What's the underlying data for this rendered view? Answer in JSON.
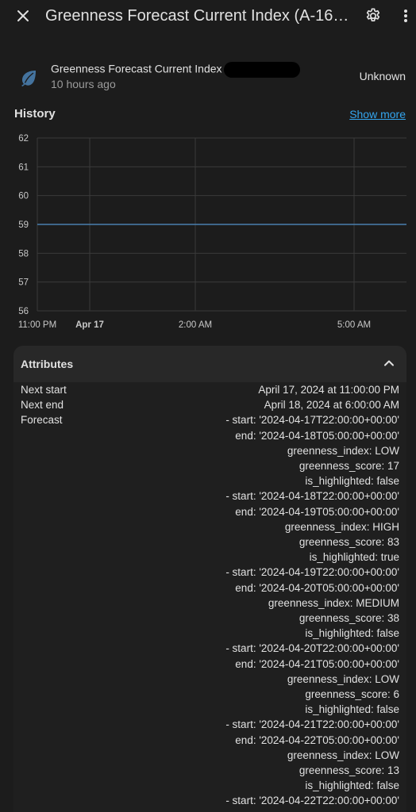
{
  "header": {
    "title": "Greenness Forecast Current Index (A-16…",
    "close_icon": "close-icon",
    "settings_icon": "gear-icon",
    "more_icon": "more-vert-icon"
  },
  "entity": {
    "name": "Greenness Forecast Current Index",
    "time": "10 hours ago",
    "state": "Unknown",
    "icon": "leaf-icon",
    "icon_color": "#44739e"
  },
  "history": {
    "title": "History",
    "show_more": "Show more"
  },
  "chart_data": {
    "type": "line",
    "ylim": [
      56,
      62
    ],
    "y_ticks": [
      "62",
      "61",
      "60",
      "59",
      "58",
      "57",
      "56"
    ],
    "x_ticks": [
      "11:00 PM",
      "Apr 17",
      "2:00 AM",
      "5:00 AM"
    ],
    "series": [
      {
        "x": [
          "11:00 PM",
          "6:30 AM"
        ],
        "values": [
          59,
          59
        ],
        "color": "#4a7fae"
      }
    ],
    "grid": true
  },
  "attributes": {
    "title": "Attributes",
    "next_start_label": "Next start",
    "next_start_value": "April 17, 2024 at 11:00:00 PM",
    "next_end_label": "Next end",
    "next_end_value": "April 18, 2024 at 6:00:00 AM",
    "forecast_label": "Forecast",
    "forecast_lines": [
      "- start: '2024-04-17T22:00:00+00:00'",
      "end: '2024-04-18T05:00:00+00:00'",
      "greenness_index: LOW",
      "greenness_score: 17",
      "is_highlighted: false",
      "- start: '2024-04-18T22:00:00+00:00'",
      "end: '2024-04-19T05:00:00+00:00'",
      "greenness_index: HIGH",
      "greenness_score: 83",
      "is_highlighted: true",
      "- start: '2024-04-19T22:00:00+00:00'",
      "end: '2024-04-20T05:00:00+00:00'",
      "greenness_index: MEDIUM",
      "greenness_score: 38",
      "is_highlighted: false",
      "- start: '2024-04-20T22:00:00+00:00'",
      "end: '2024-04-21T05:00:00+00:00'",
      "greenness_index: LOW",
      "greenness_score: 6",
      "is_highlighted: false",
      "- start: '2024-04-21T22:00:00+00:00'",
      "end: '2024-04-22T05:00:00+00:00'",
      "greenness_index: LOW",
      "greenness_score: 13",
      "is_highlighted: false",
      "- start: '2024-04-22T22:00:00+00:00'"
    ]
  }
}
